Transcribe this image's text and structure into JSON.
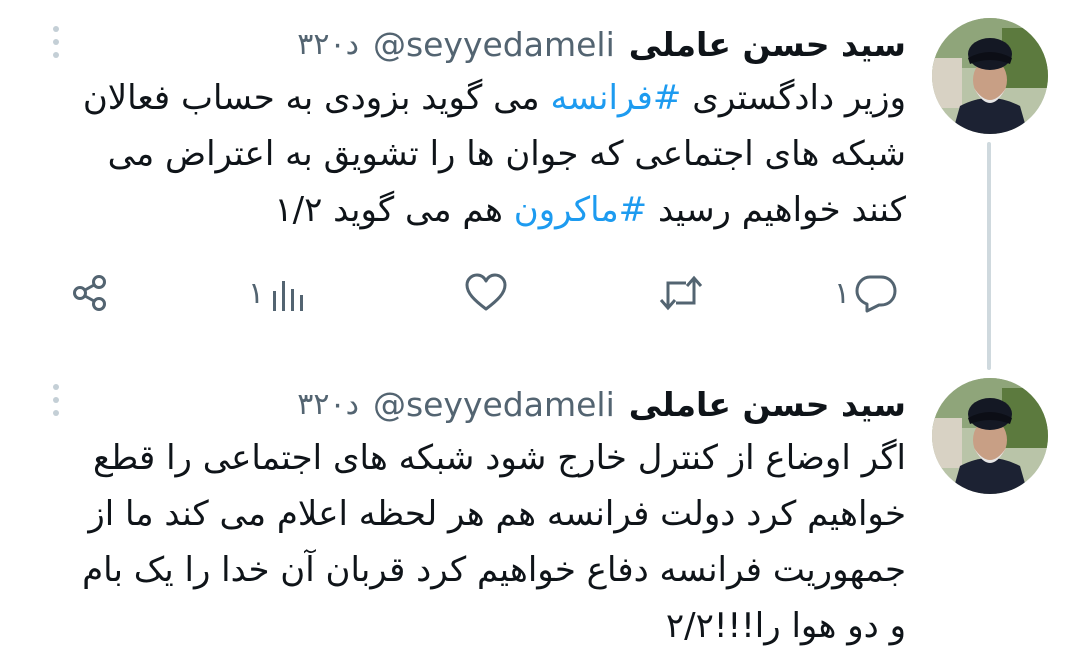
{
  "tweets": [
    {
      "author_name": "سید حسن عاملی",
      "handle": "@seyyedameli",
      "time": "۳۲۰د",
      "text_lines": [
        [
          {
            "t": "وزیر دادگستری ",
            "hashtag": false
          },
          {
            "t": "#فرانسه",
            "hashtag": true
          },
          {
            "t": " می گوید بزودی به حساب فعالان",
            "hashtag": false
          }
        ],
        [
          {
            "t": "شبکه های اجتماعی که جوان ها را تشویق به اعتراض می",
            "hashtag": false
          }
        ],
        [
          {
            "t": "کنند خواهیم رسید ",
            "hashtag": false
          },
          {
            "t": "#ماکرون",
            "hashtag": true
          },
          {
            "t": " هم می گوید ۱/۲",
            "hashtag": false
          }
        ]
      ],
      "actions": {
        "reply_count": "۱",
        "retweet_count": "",
        "like_count": "",
        "views_count": "۱"
      }
    },
    {
      "author_name": "سید حسن عاملی",
      "handle": "@seyyedameli",
      "time": "۳۲۰د",
      "text_lines": [
        [
          {
            "t": "اگر اوضاع از کنترل خارج شود شبکه های اجتماعی را قطع",
            "hashtag": false
          }
        ],
        [
          {
            "t": "خواهیم کرد دولت فرانسه هم هر لحظه اعلام می کند ما از",
            "hashtag": false
          }
        ],
        [
          {
            "t": "جمهوریت فرانسه دفاع خواهیم کرد قربان آن خدا را یک بام",
            "hashtag": false
          }
        ],
        [
          {
            "t": "و دو هوا را!!!۲/۲",
            "hashtag": false
          }
        ]
      ]
    }
  ],
  "colors": {
    "text": "#0f1419",
    "secondary": "#536471",
    "hashtag": "#1d9bf0",
    "thread_line": "#cfd9de",
    "background": "#ffffff"
  },
  "icons": {
    "more": "more-vertical-icon",
    "reply": "reply-bubble-icon",
    "retweet": "retweet-icon",
    "like": "heart-icon",
    "views": "views-bars-icon",
    "share": "share-icon"
  }
}
